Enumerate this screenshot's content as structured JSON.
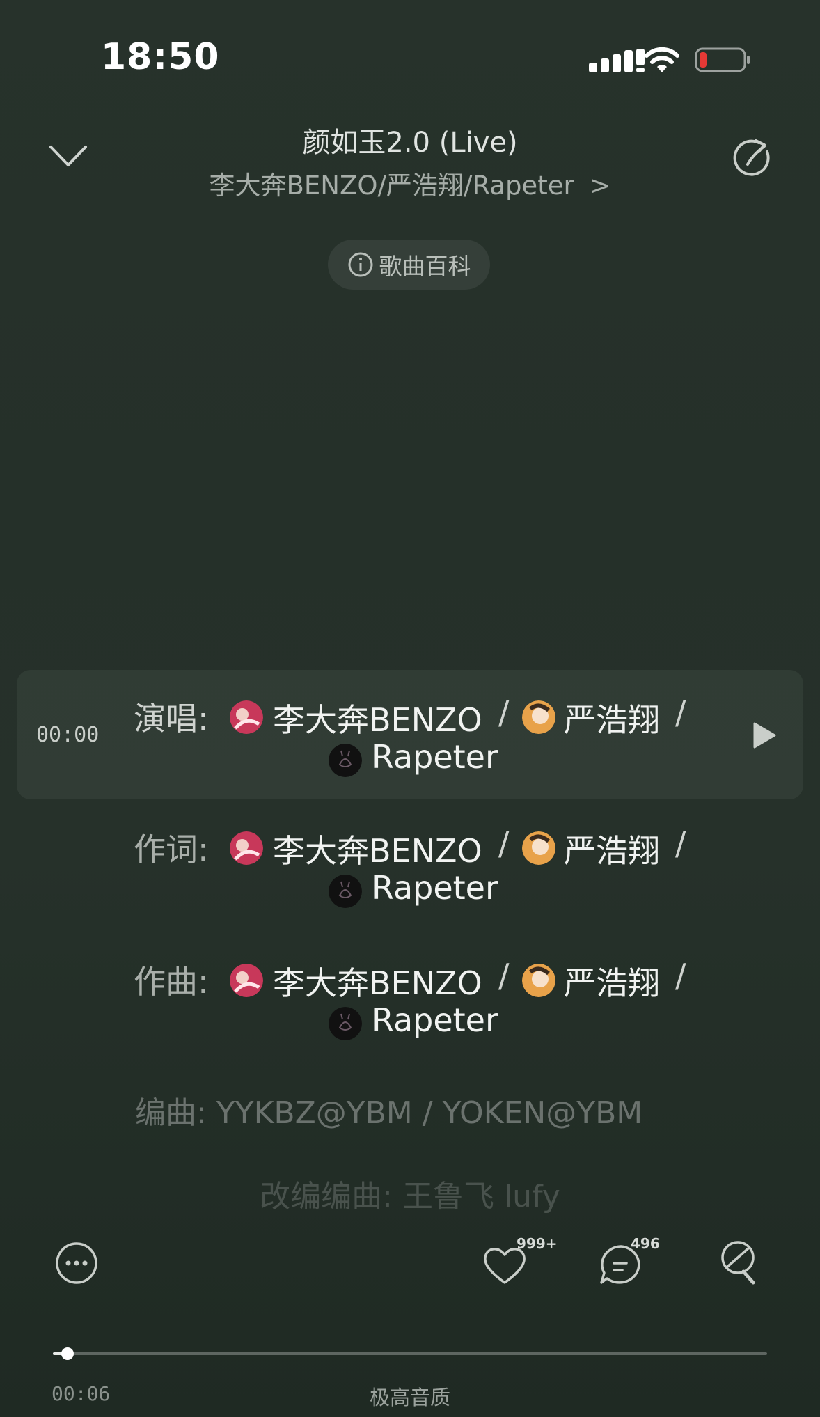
{
  "status_bar": {
    "time": "18:50",
    "battery_color": "#e53935"
  },
  "header": {
    "title": "颜如玉2.0 (Live)",
    "artists": "李大奔BENZO/严浩翔/Rapeter",
    "artists_chevron": ">",
    "wiki_label": "歌曲百科"
  },
  "credits": {
    "timestamp": "00:00",
    "rows": [
      {
        "label": "演唱:",
        "artist1": "李大奔BENZO",
        "artist2": "严浩翔",
        "artist3": "Rapeter",
        "sep": "/"
      },
      {
        "label": "作词:",
        "artist1": "李大奔BENZO",
        "artist2": "严浩翔",
        "artist3": "Rapeter",
        "sep": "/"
      },
      {
        "label": "作曲:",
        "artist1": "李大奔BENZO",
        "artist2": "严浩翔",
        "artist3": "Rapeter",
        "sep": "/"
      }
    ],
    "arrangement": "编曲:  YYKBZ@YBM / YOKEN@YBM",
    "adaptation": "改编编曲:  王鲁飞 lufy"
  },
  "actions": {
    "like_count": "999+",
    "comment_count": "496"
  },
  "player": {
    "elapsed": "00:06",
    "progress_fraction": 0.02,
    "quality": "极高音质"
  },
  "colors": {
    "background": "#26312a",
    "avatar_benzo": "#c8385a",
    "avatar_yan": "#e8a24a",
    "avatar_rapeter": "#111111"
  }
}
